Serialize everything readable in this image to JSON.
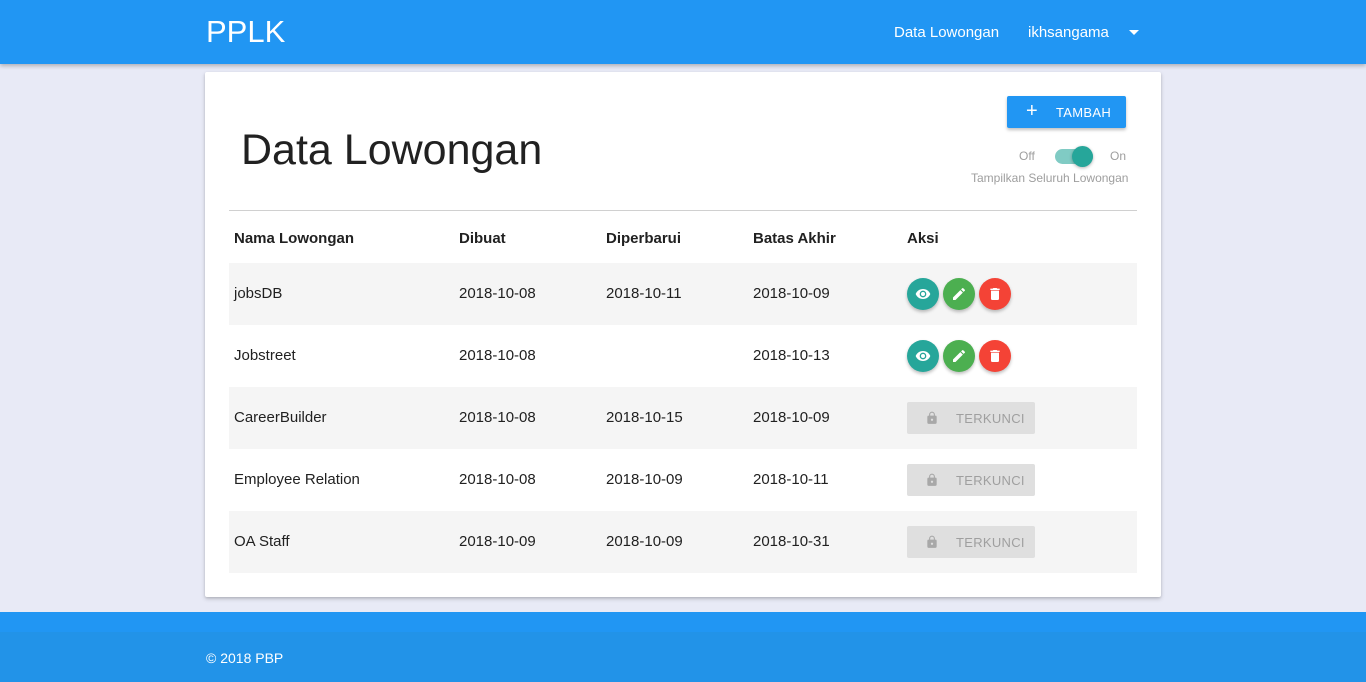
{
  "navbar": {
    "brand": "PPLK",
    "links": {
      "lowongan": "Data Lowongan",
      "user": "ikhsangama"
    },
    "color": "#2196f3"
  },
  "page": {
    "title": "Data Lowongan",
    "add_button": "TAMBAH",
    "switch": {
      "off_label": "Off",
      "on_label": "On",
      "state": "on",
      "caption": "Tampilkan Seluruh Lowongan"
    }
  },
  "table": {
    "headers": [
      "Nama Lowongan",
      "Dibuat",
      "Diperbarui",
      "Batas Akhir",
      "Aksi"
    ],
    "rows": [
      {
        "name": "jobsDB",
        "created": "2018-10-08",
        "updated": "2018-10-11",
        "deadline": "2018-10-09",
        "action": "buttons"
      },
      {
        "name": "Jobstreet",
        "created": "2018-10-08",
        "updated": "",
        "deadline": "2018-10-13",
        "action": "buttons"
      },
      {
        "name": "CareerBuilder",
        "created": "2018-10-08",
        "updated": "2018-10-15",
        "deadline": "2018-10-09",
        "action": "locked"
      },
      {
        "name": "Employee Relation",
        "created": "2018-10-08",
        "updated": "2018-10-09",
        "deadline": "2018-10-11",
        "action": "locked"
      },
      {
        "name": "OA Staff",
        "created": "2018-10-09",
        "updated": "2018-10-09",
        "deadline": "2018-10-31",
        "action": "locked"
      }
    ],
    "locked_label": "TERKUNCI",
    "action_icons": [
      "eye-icon",
      "pencil-icon",
      "trash-icon"
    ]
  },
  "footer": {
    "copyright": "© 2018 PBP"
  }
}
